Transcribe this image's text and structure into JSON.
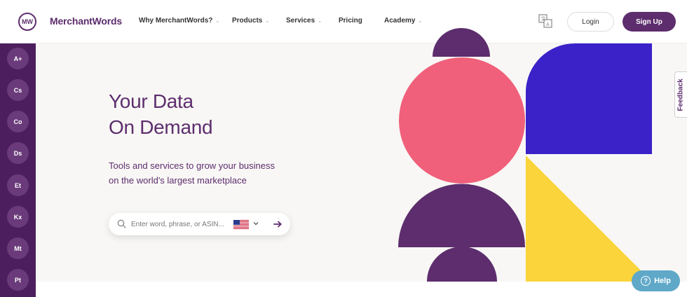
{
  "header": {
    "logo_mark": "MW",
    "logo_text": "MerchantWords",
    "nav": [
      {
        "label": "Why MerchantWords?",
        "has_dropdown": true
      },
      {
        "label": "Products",
        "has_dropdown": true
      },
      {
        "label": "Services",
        "has_dropdown": true
      },
      {
        "label": "Pricing",
        "has_dropdown": false
      },
      {
        "label": "Academy",
        "has_dropdown": true
      }
    ],
    "translate_icon": "translate-icon",
    "login_label": "Login",
    "signup_label": "Sign Up"
  },
  "sidebar": {
    "items": [
      {
        "label": "A+"
      },
      {
        "label": "Cs"
      },
      {
        "label": "Co"
      },
      {
        "label": "Ds"
      },
      {
        "label": "Et"
      },
      {
        "label": "Kx"
      },
      {
        "label": "Mt"
      },
      {
        "label": "Pt"
      }
    ]
  },
  "hero": {
    "title_line1": "Your Data",
    "title_line2": "On Demand",
    "subtitle_line1": "Tools and services to grow your business",
    "subtitle_line2": "on the world's largest marketplace",
    "search": {
      "placeholder": "Enter word, phrase, or ASIN...",
      "value": "",
      "marketplace_flag": "us-flag-icon"
    }
  },
  "feedback_label": "Feedback",
  "help_label": "Help",
  "colors": {
    "brand_purple": "#5d2d6d",
    "sidebar_purple": "#4d1e5e",
    "pink": "#f0607a",
    "blue": "#3a22c8",
    "yellow": "#fad43a",
    "help_blue": "#5fa8c8"
  }
}
